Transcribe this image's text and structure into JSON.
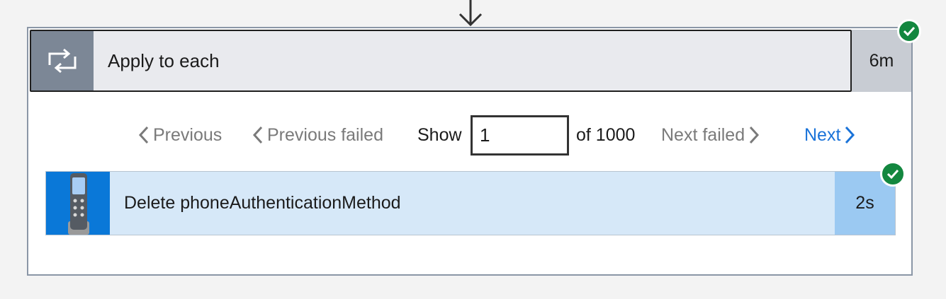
{
  "flow": {
    "connector_icon": "arrow-down-icon"
  },
  "loop": {
    "title": "Apply to each",
    "duration": "6m",
    "icon": "loop-icon",
    "status_icon": "success-check-icon",
    "colors": {
      "icon_bg": "#7c8796",
      "header_bg": "#e9eaee",
      "duration_bg": "#c8ccd3",
      "success": "#13873f"
    }
  },
  "pager": {
    "previous_label": "Previous",
    "previous_failed_label": "Previous failed",
    "show_label": "Show",
    "current_value": "1",
    "of_label": "of 1000",
    "next_failed_label": "Next failed",
    "next_label": "Next",
    "colors": {
      "disabled": "#7a7a7a",
      "active": "#1a73d9"
    }
  },
  "action": {
    "title": "Delete phoneAuthenticationMethod",
    "duration": "2s",
    "icon": "phone-icon",
    "status_icon": "success-check-icon",
    "colors": {
      "icon_bg": "#0a78d8",
      "row_bg": "#d6e8f8",
      "duration_bg": "#9bc9f2"
    }
  }
}
